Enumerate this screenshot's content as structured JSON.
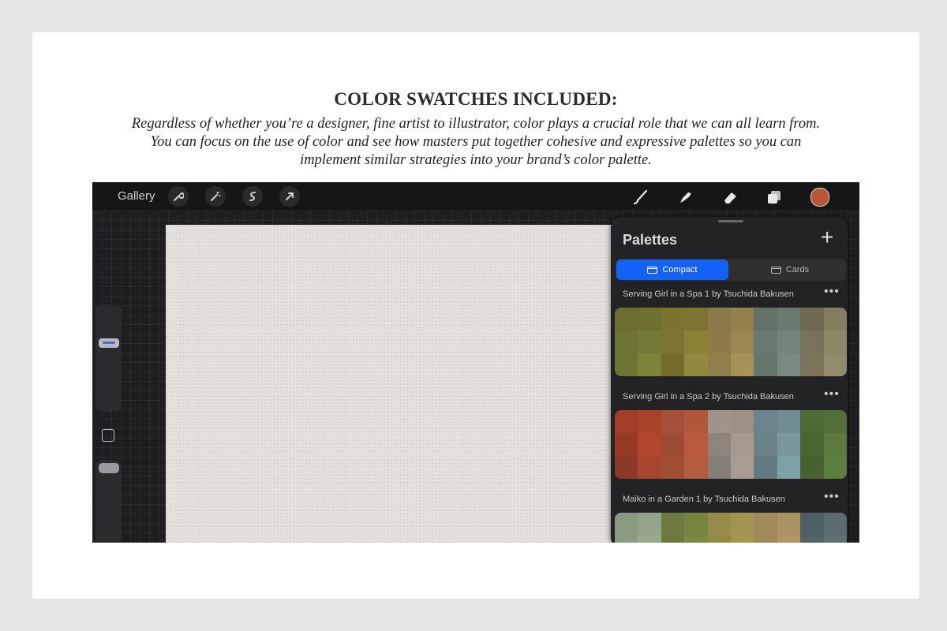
{
  "heading": "COLOR SWATCHES INCLUDED:",
  "intro": "Regardless of whether you’re a designer, fine artist to illustrator, color plays a crucial role that we can all learn from. You can focus on the use of color and see how masters put together cohesive and expressive palettes so you can implement similar strategies into your brand’s color palette.",
  "toolbar": {
    "gallery_label": "Gallery",
    "left_tools": [
      "wrench-icon",
      "magic-wand-icon",
      "selection-icon",
      "transform-arrow-icon"
    ],
    "right_tools": [
      "brush-icon",
      "smudge-icon",
      "eraser-icon",
      "layers-icon"
    ],
    "current_color": "#b8563a"
  },
  "palettes_panel": {
    "title": "Palettes",
    "add_icon": "+",
    "view_modes": {
      "active": "Compact",
      "inactive": "Cards"
    },
    "more_label": "•••",
    "palettes": [
      {
        "name": "Serving Girl in a Spa 1 by Tsuchida Bakusen",
        "colors": [
          "#6b6e2e",
          "#6d702f",
          "#7a722e",
          "#7c7432",
          "#8b7a4a",
          "#95814c",
          "#647266",
          "#6b7a70",
          "#706a52",
          "#847d60",
          "#6e7532",
          "#727a35",
          "#7c7430",
          "#878236",
          "#8c7b48",
          "#9b8650",
          "#6a7a70",
          "#748478",
          "#7a7258",
          "#8c8566",
          "#6d7333",
          "#7b8438",
          "#756b2c",
          "#8f8a3e",
          "#8d7e4c",
          "#a49257",
          "#67766d",
          "#7a8a82",
          "#7c735b",
          "#918a6c"
        ]
      },
      {
        "name": "Serving Girl in a Spa 2 by Tsuchida Bakusen",
        "colors": [
          "#a03e28",
          "#a8432b",
          "#a5513a",
          "#b0563c",
          "#a09489",
          "#9c8f86",
          "#6b838a",
          "#718c92",
          "#4e6a36",
          "#566f3a",
          "#963a27",
          "#b0482e",
          "#9c4c34",
          "#b85a3c",
          "#8e847b",
          "#a69a90",
          "#6a8187",
          "#7a979c",
          "#4b6532",
          "#5a7a3e",
          "#8c3826",
          "#a8472d",
          "#a04e34",
          "#b45c3e",
          "#877e76",
          "#a89c92",
          "#627a80",
          "#7ca1a6",
          "#47612f",
          "#5c7f3f"
        ]
      },
      {
        "name": "Maiko in a Garden 1 by Tsuchida Bakusen",
        "colors": [
          "#8a9a80",
          "#94a488",
          "#6e7a40",
          "#76843f",
          "#958a48",
          "#a09450",
          "#a2895c",
          "#ab9360",
          "#4e6066",
          "#5a6c70",
          "#8a9c84",
          "#9aaa8c",
          "#6c7a3e",
          "#7b8a42",
          "#948a46",
          "#a4984e",
          "#a08a5a",
          "#b09866",
          "#526468",
          "#5e7072"
        ]
      }
    ]
  }
}
